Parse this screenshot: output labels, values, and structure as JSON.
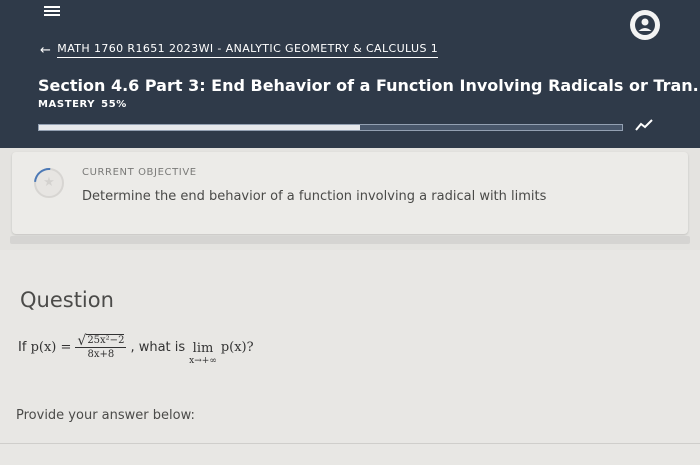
{
  "header": {
    "breadcrumb": "MATH 1760 R1651 2023WI - ANALYTIC GEOMETRY & CALCULUS 1",
    "title": "Section 4.6 Part 3: End Behavior of a Function Involving Radicals or Tran...",
    "mastery_label": "MASTERY",
    "mastery_value": "55%",
    "mastery_progress": 0.55,
    "colors": {
      "background": "#2f3a49",
      "progress_fill": "#e6e8eb"
    },
    "icons": [
      "menu-icon",
      "back-arrow-icon",
      "avatar-icon",
      "trend-icon"
    ]
  },
  "objective": {
    "label": "CURRENT OBJECTIVE",
    "text": "Determine the end behavior of a function involving a radical with limits",
    "icon": "star-icon"
  },
  "question": {
    "heading": "Question",
    "prefix": "If",
    "function_lhs": "p(x) =",
    "numerator_radicand": "25x²−2",
    "denominator": "8x+8",
    "middle": ", what is",
    "lim_word": "lim",
    "lim_sub": "x→+∞",
    "suffix": "p(x)?",
    "answer_prompt": "Provide your answer below:"
  }
}
